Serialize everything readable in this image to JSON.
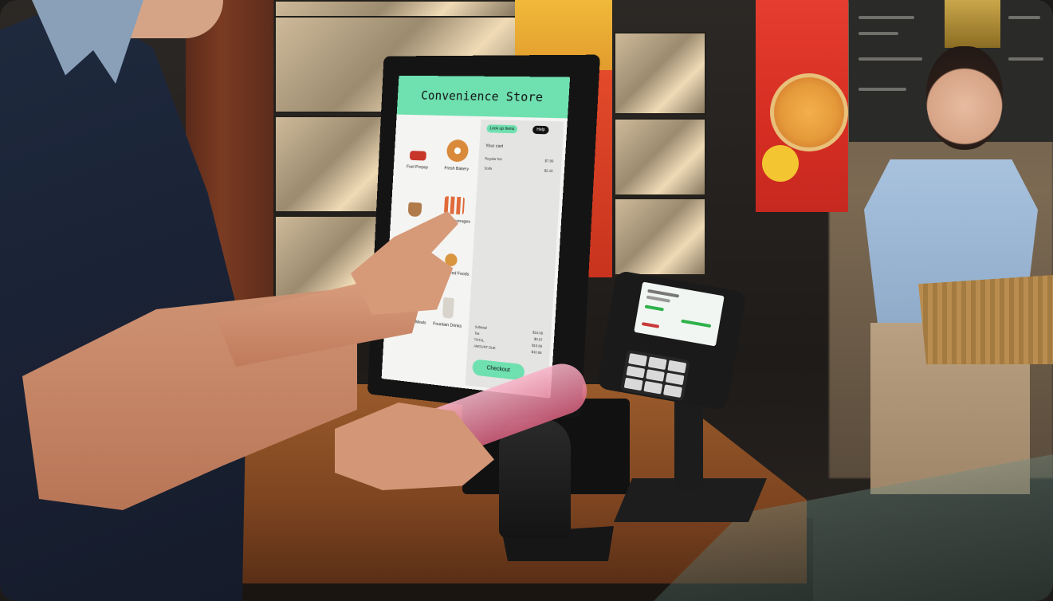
{
  "kiosk": {
    "title": "Convenience Store",
    "menu_items": [
      {
        "label": "Fuel Prepay",
        "icon": "fuel-nozzle-icon",
        "color": "#c8362a"
      },
      {
        "label": "Fresh Bakery",
        "icon": "donut-icon",
        "color": "#d98a3a"
      },
      {
        "label": "",
        "icon": "coffee-cup-icon",
        "color": "#b07a4a"
      },
      {
        "label": "Bottled Beverages",
        "icon": "bottles-icon",
        "color": "#e06a3a"
      },
      {
        "label": "",
        "icon": "snack-icon",
        "color": "#e7a550"
      },
      {
        "label": "Hot Prepared Foods",
        "icon": "hot-food-icon",
        "color": "#d9963f"
      },
      {
        "label": "Grab-and-Go Meals",
        "icon": "sandwich-icon",
        "color": "#c89a63"
      },
      {
        "label": "Fountain Drinks",
        "icon": "fountain-cup-icon",
        "color": "#d8d4cc"
      }
    ],
    "lookup_button": "Look up Items",
    "help_button": "Help",
    "cart_heading": "Your cart",
    "cart_items": [
      {
        "name": "Regular hot",
        "price": "$7.99"
      },
      {
        "name": "Soda",
        "price": "$2.10"
      }
    ],
    "totals": [
      {
        "label": "Subtotal",
        "value": "$10.09"
      },
      {
        "label": "Tax",
        "value": "$0.57"
      },
      {
        "label": "TOTAL",
        "value": "$10.66"
      },
      {
        "label": "AMOUNT DUE",
        "value": "$10.66"
      }
    ],
    "checkout_button": "Checkout"
  },
  "terminal": {
    "accent_color": "#2fb24a"
  }
}
